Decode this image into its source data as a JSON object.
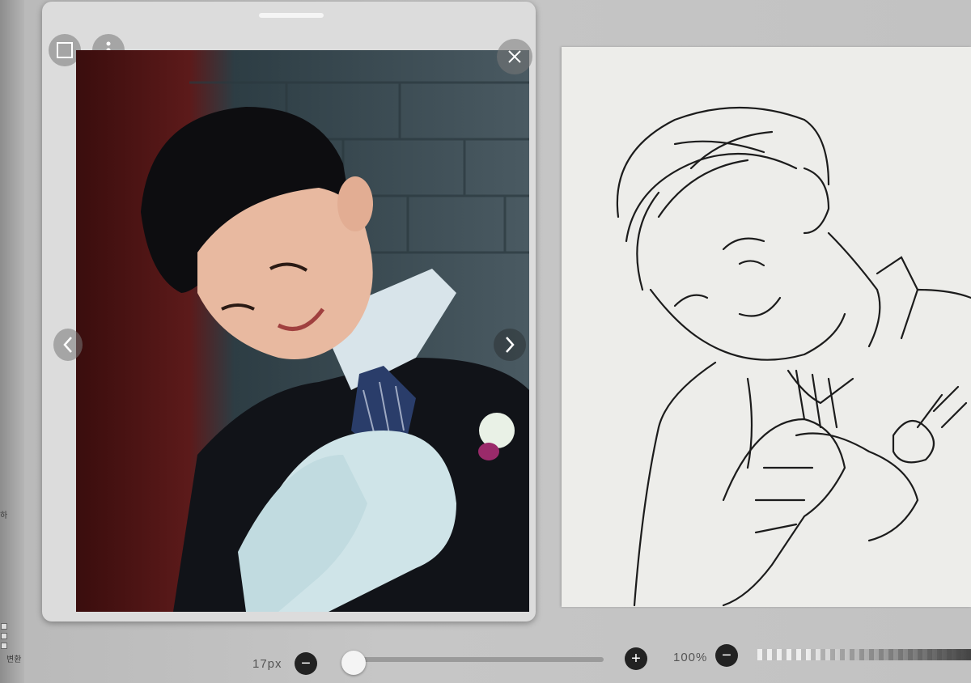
{
  "reference_window": {
    "close_icon": "close-icon",
    "menu_icon": "more-vertical-icon",
    "toggle_icon": "square-icon",
    "prev_icon": "chevron-left-icon",
    "next_icon": "chevron-right-icon",
    "photo_desc_icon": "reference-photo"
  },
  "toolbar": {
    "brush_size": "17px",
    "brush_size_fraction": 0.05,
    "zoom": "100%",
    "minus_label": "−",
    "plus_label": "+"
  },
  "left_strip": {
    "label_a": "하",
    "label_b": "변환"
  },
  "colors": {
    "window_bg": "#dcdcdc",
    "canvas_bg": "#ededea",
    "button_dark": "#222222"
  }
}
